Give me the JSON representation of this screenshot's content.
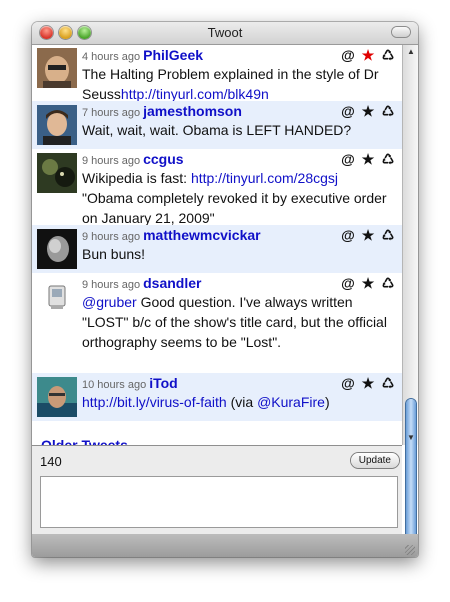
{
  "window": {
    "title": "Twoot"
  },
  "tweets": [
    {
      "time": "4 hours ago",
      "user": "PhilGeek",
      "text_before": "The Halting Problem explained in the style of Dr Seuss",
      "link": "http://tinyurl.com/blk49n",
      "text_after": "",
      "favorited": true
    },
    {
      "time": "7 hours ago",
      "user": "jamesthomson",
      "text": "Wait, wait, wait. Obama is LEFT HANDED?",
      "favorited": false
    },
    {
      "time": "9 hours ago",
      "user": "ccgus",
      "text_before": "Wikipedia is fast: ",
      "link": "http://tinyurl.com/28cgsj",
      "text_after": "\"Obama completely revoked it by executive order on January 21, 2009\"",
      "favorited": false
    },
    {
      "time": "9 hours ago",
      "user": "matthewmcvickar",
      "text": "Bun buns!",
      "favorited": false
    },
    {
      "time": "9 hours ago",
      "user": "dsandler",
      "mention": "@gruber",
      "text_after": " Good question. I've always written \"LOST\" b/c of the show's title card, but the official orthography seems to be \"Lost\".",
      "favorited": false
    },
    {
      "time": "10 hours ago",
      "user": "iTod",
      "link": "http://bit.ly/virus-of-faith",
      "text_mid": " (via ",
      "mention": "@KuraFire",
      "text_after": ")",
      "favorited": false
    }
  ],
  "actions": {
    "reply": "@",
    "favorite": "★",
    "retweet": "♺"
  },
  "older": "Older Tweets",
  "composer": {
    "count": "140",
    "update": "Update"
  },
  "colors": {
    "link": "#1010c8",
    "alt_row": "#e7effc",
    "fav_on": "#e00000"
  }
}
